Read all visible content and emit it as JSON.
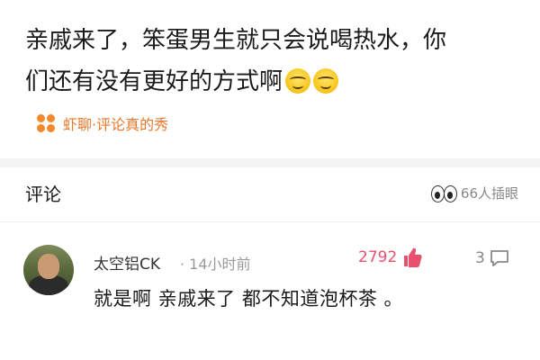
{
  "post": {
    "text_line1": "亲戚来了，笨蛋男生就只会说喝热水，你",
    "text_line2": "们还有没有更好的方式啊",
    "emoji_count": 2
  },
  "source": {
    "label": "虾聊·评论真的秀",
    "icon": "four-dots-icon",
    "color": "#e8772a"
  },
  "comments_section": {
    "title": "评论",
    "viewers": "66人插眼",
    "viewers_icon": "peeking-eyes-icon"
  },
  "comment": {
    "username": "太空铝CK",
    "time": "· 14小时前",
    "likes": "2792",
    "likes_color": "#e9506e",
    "replies": "3",
    "text": "就是啊  亲戚来了 都不知道泡杯茶 。"
  }
}
